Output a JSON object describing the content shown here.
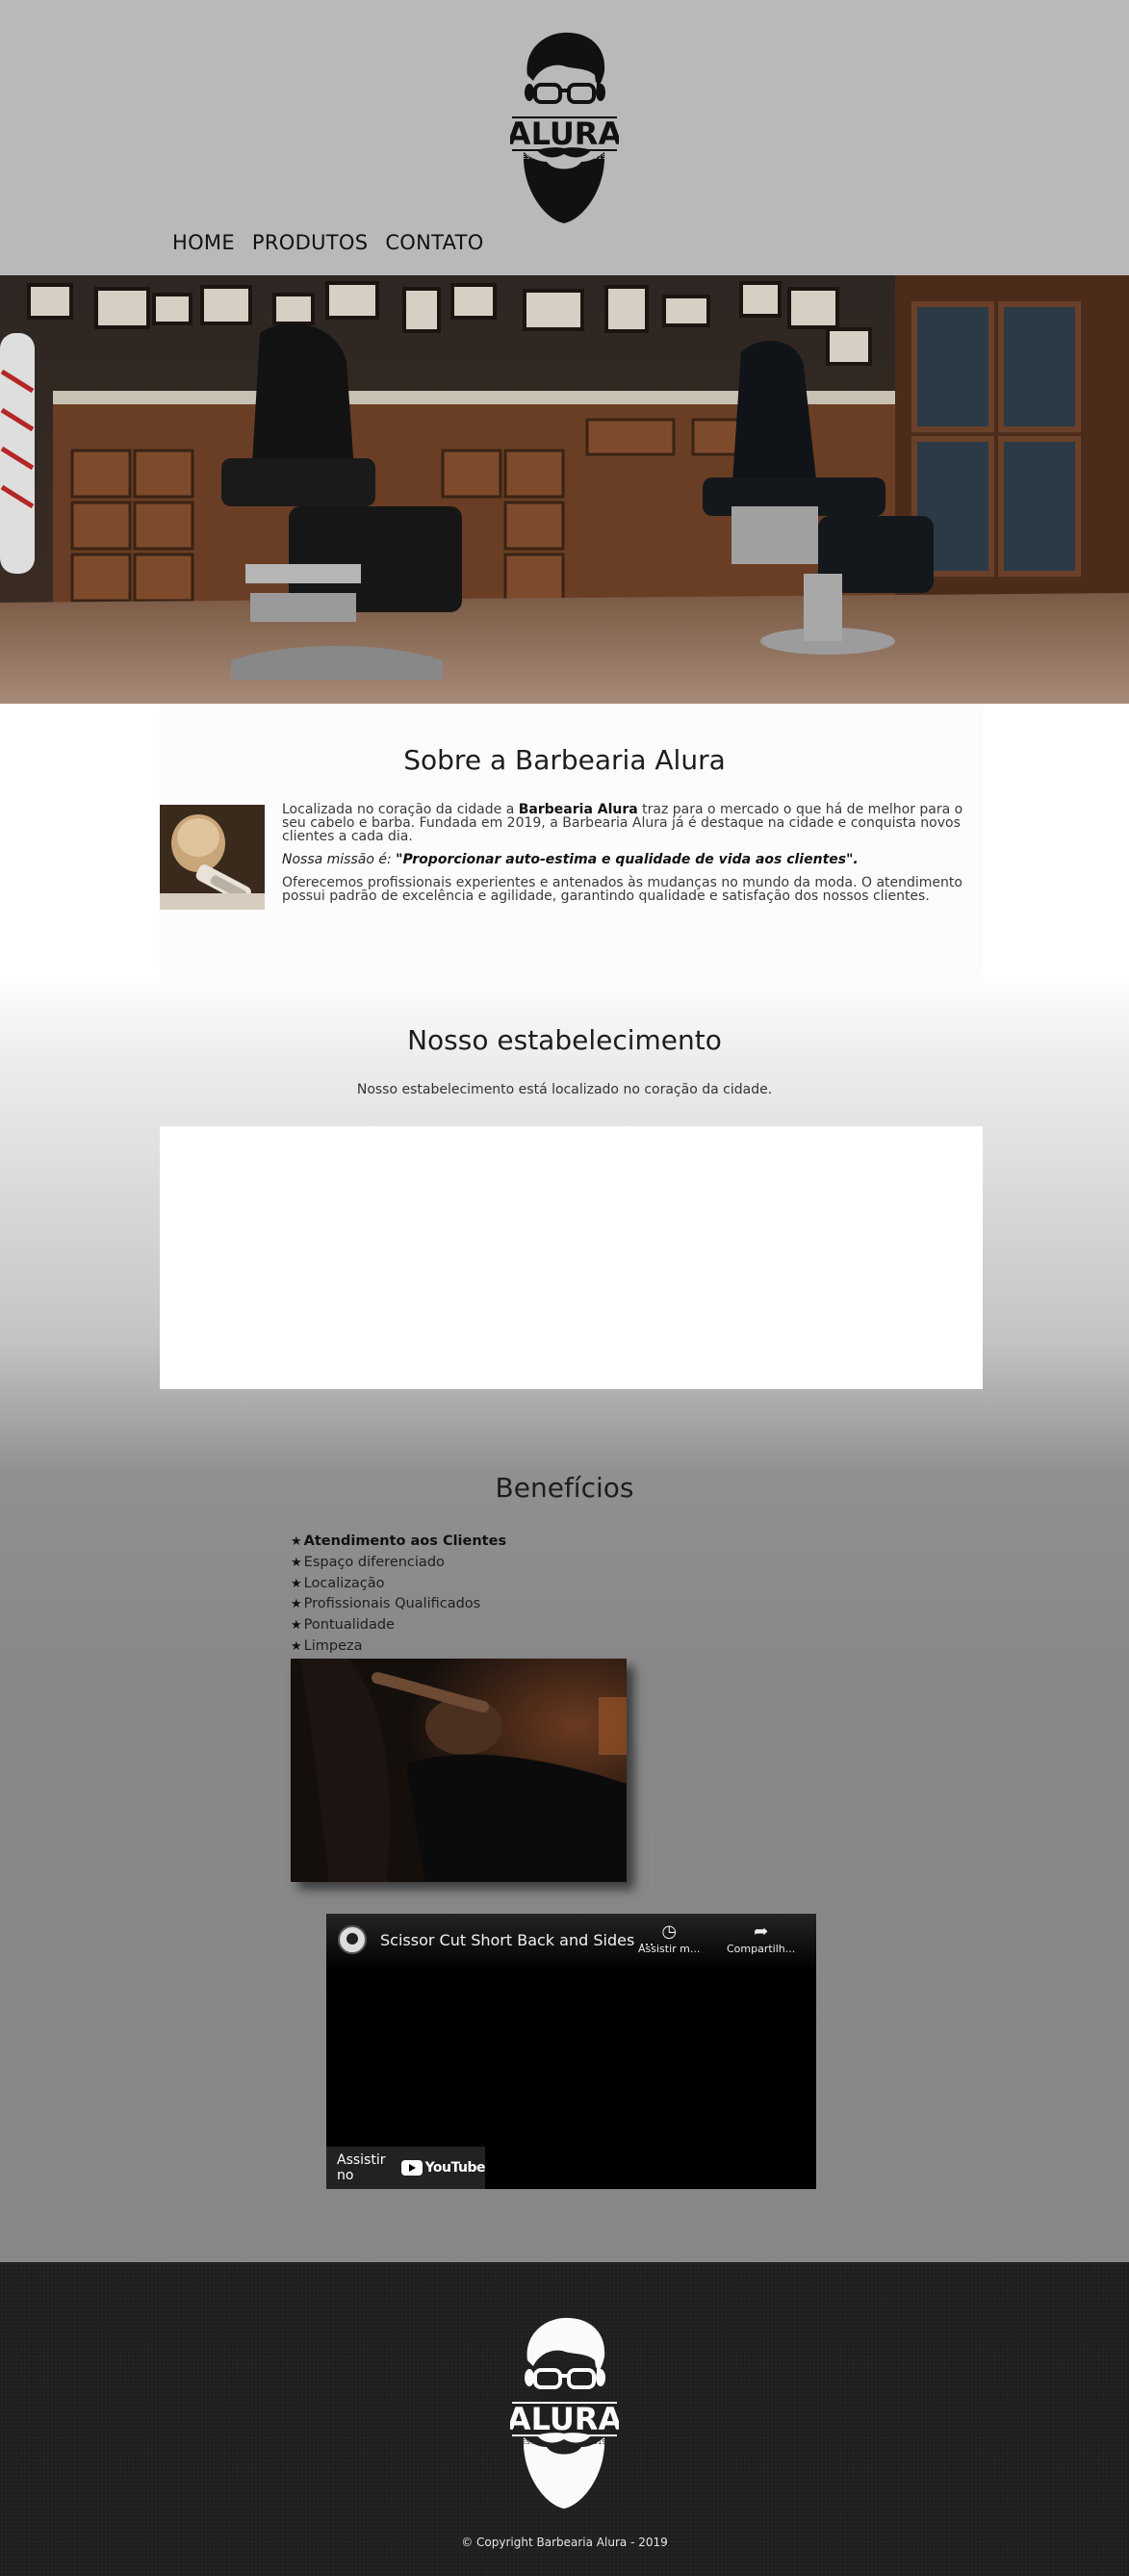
{
  "brand": {
    "name": "ALURA",
    "estd_left": "ESTD",
    "estd_right": "2019"
  },
  "nav": {
    "items": [
      "HOME",
      "PRODUTOS",
      "CONTATO"
    ]
  },
  "about": {
    "title": "Sobre a Barbearia Alura",
    "p1_before": "Localizada no coração da cidade a ",
    "p1_bold": "Barbearia Alura",
    "p1_after": " traz para o mercado o que há de melhor para o seu cabelo e barba. Fundada em 2019, a Barbearia Alura já é destaque na cidade e conquista novos clientes a cada dia.",
    "mission_label": "Nossa missão é:",
    "mission_quote": "\"Proporcionar auto-estima e qualidade de vida aos clientes\".",
    "p3": "Oferecemos profissionais experientes e antenados às mudanças no mundo da moda. O atendimento possui padrão de excelência e agilidade, garantindo qualidade e satisfação dos nossos clientes."
  },
  "location": {
    "title": "Nosso estabelecimento",
    "subtitle": "Nosso estabelecimento está localizado no coração da cidade."
  },
  "benefits": {
    "title": "Benefícios",
    "star_icon": "★",
    "items": [
      "Atendimento aos Clientes",
      "Espaço diferenciado",
      "Localização",
      "Profissionais Qualificados",
      "Pontualidade",
      "Limpeza"
    ]
  },
  "video": {
    "title": "Scissor Cut Short Back and Sides ...",
    "watch_later": "Assistir m...",
    "share": "Compartilh...",
    "watch_on": "Assistir no",
    "youtube": "YouTube"
  },
  "footer": {
    "copyright": "© Copyright Barbearia Alura - 2019"
  },
  "colors": {
    "header_bg": "#b9b9b9",
    "footer_bg": "#1f1f1f",
    "text_dark": "#1d1d1d"
  }
}
